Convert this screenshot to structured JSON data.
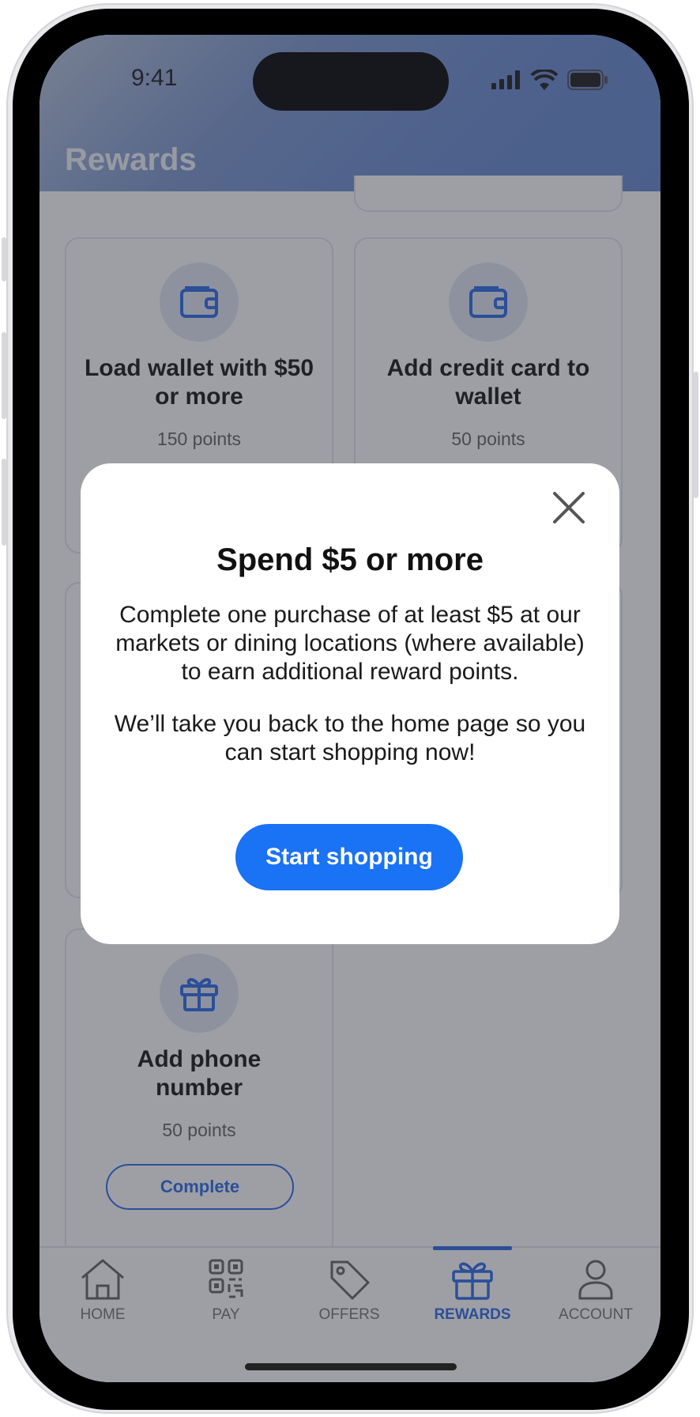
{
  "status_bar": {
    "time": "9:41"
  },
  "header": {
    "title": "Rewards"
  },
  "cards": [
    {
      "title": "Load wallet with $50 or more",
      "points": "150 points",
      "icon": "wallet-icon"
    },
    {
      "title": "Add credit card to wallet",
      "points": "50 points",
      "icon": "wallet-icon"
    },
    {
      "title": "Add phone number",
      "points": "50 points",
      "icon": "gift-icon",
      "button": "Complete"
    }
  ],
  "modal": {
    "title": "Spend $5 or more",
    "paragraph1": "Complete one purchase of at least $5 at our markets or dining locations (where available) to earn additional reward points.",
    "paragraph2": "We’ll take you back to the home page so you can start shopping now!",
    "button": "Start shopping"
  },
  "tabs": [
    {
      "label": "HOME",
      "icon": "home-icon"
    },
    {
      "label": "PAY",
      "icon": "qr-code-icon"
    },
    {
      "label": "OFFERS",
      "icon": "tag-icon"
    },
    {
      "label": "REWARDS",
      "icon": "gift-icon",
      "active": true
    },
    {
      "label": "ACCOUNT",
      "icon": "person-icon"
    }
  ],
  "colors": {
    "accent": "#1a72f5",
    "header_gradient_end": "#6a8bd1"
  }
}
